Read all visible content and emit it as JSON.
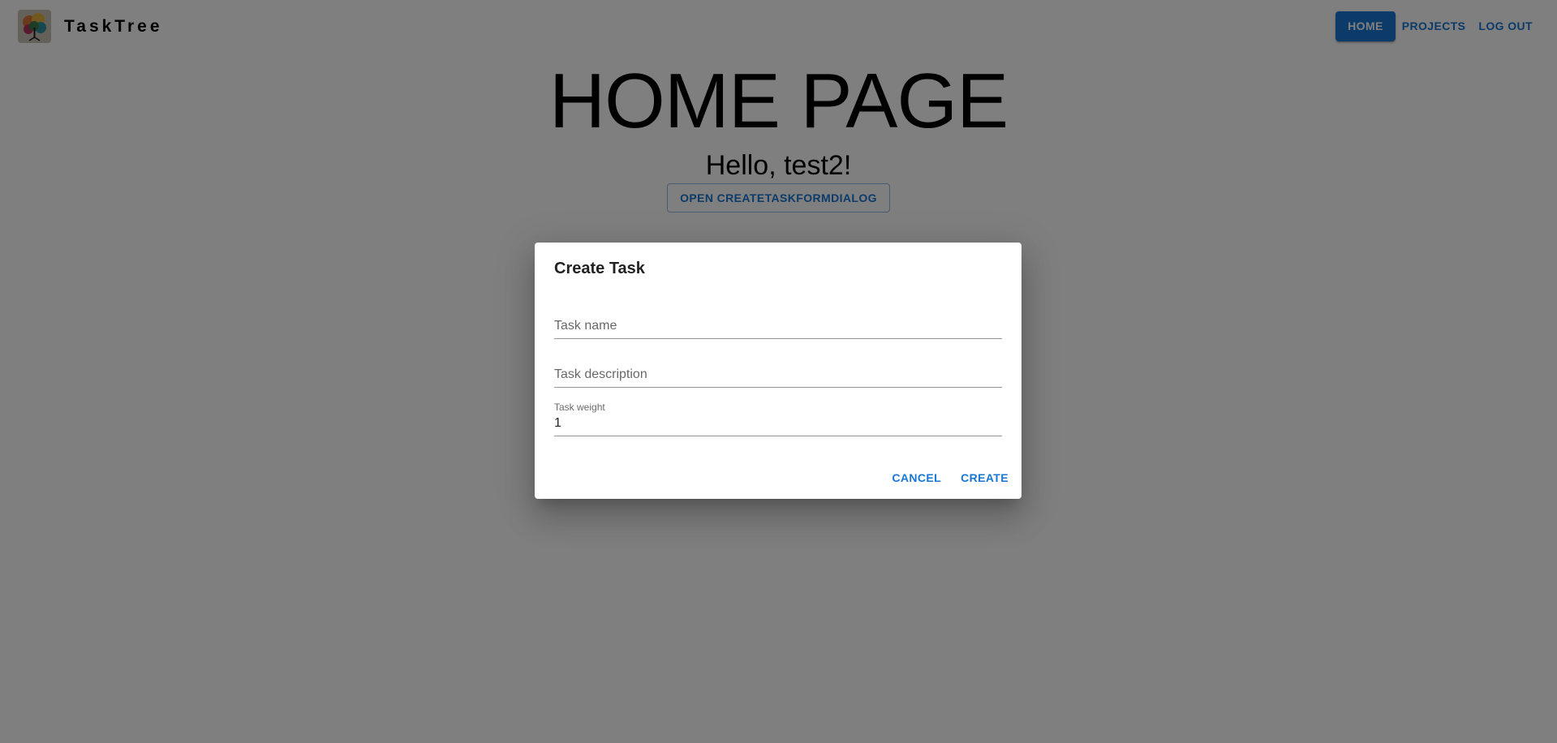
{
  "app": {
    "brand_name": "TaskTree",
    "logo_icon": "tree-logo-icon"
  },
  "nav": {
    "items": [
      {
        "label": "HOME",
        "active": true
      },
      {
        "label": "PROJECTS",
        "active": false
      },
      {
        "label": "LOG OUT",
        "active": false
      }
    ]
  },
  "main": {
    "title": "HOME PAGE",
    "greeting": "Hello, test2!",
    "open_dialog_label": "OPEN CREATETASKFORMDIALOG"
  },
  "dialog": {
    "title": "Create Task",
    "fields": {
      "task_name": {
        "placeholder": "Task name",
        "value": ""
      },
      "task_description": {
        "placeholder": "Task description",
        "value": ""
      },
      "task_weight": {
        "label": "Task weight",
        "value": "1"
      }
    },
    "actions": {
      "cancel_label": "CANCEL",
      "create_label": "CREATE"
    }
  },
  "colors": {
    "accent": "#1976d2",
    "backdrop": "rgba(0,0,0,0.5)"
  }
}
